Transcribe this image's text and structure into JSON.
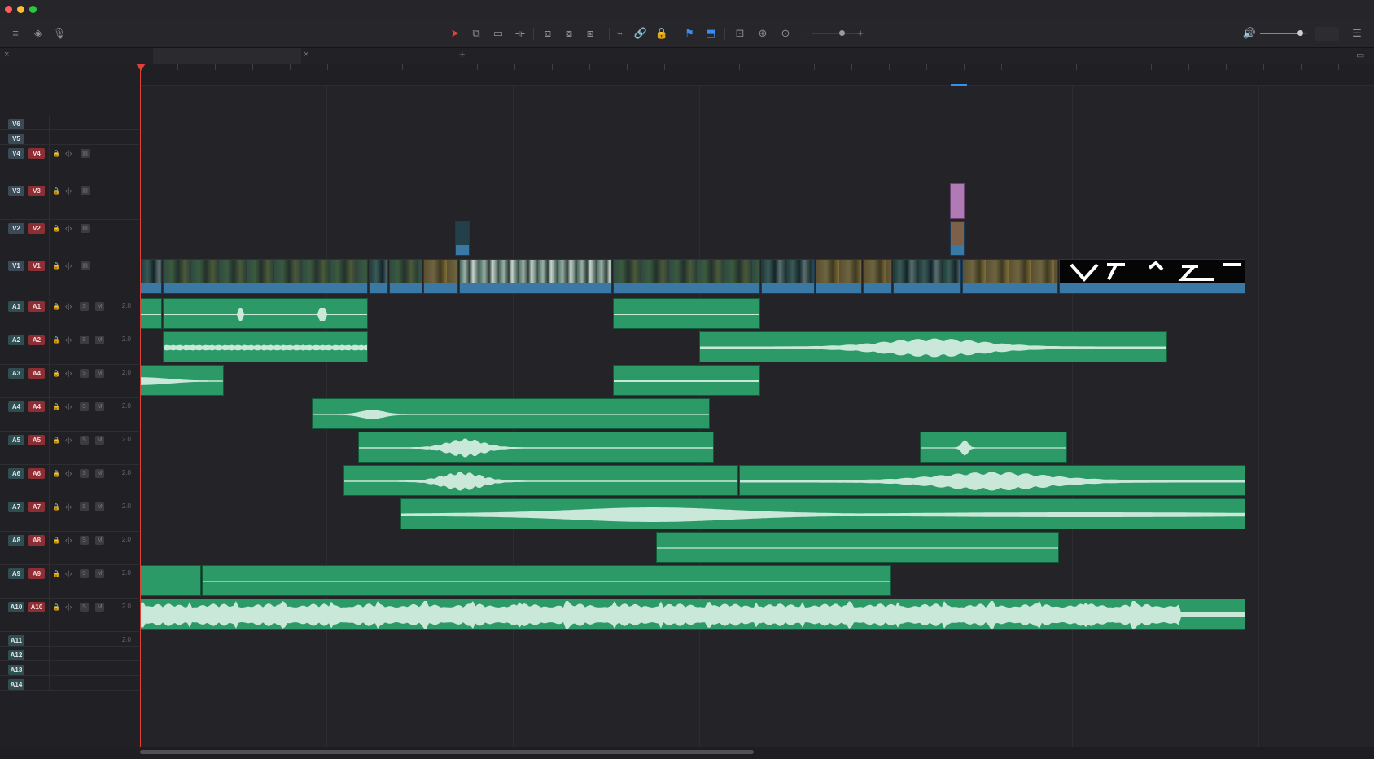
{
  "window": {
    "traffic_lights": [
      {
        "name": "close",
        "color": "#ff5f57"
      },
      {
        "name": "minimize",
        "color": "#febc2e"
      },
      {
        "name": "zoom",
        "color": "#28c840"
      }
    ]
  },
  "toolbar": {
    "left_tools": [
      {
        "name": "timeline-view-options-icon",
        "glyph": "≡"
      },
      {
        "name": "audio-mixer-icon",
        "glyph": "◈"
      },
      {
        "name": "voiceover-mic-icon",
        "glyph": "🎙"
      }
    ],
    "edit_tools": [
      {
        "name": "selection-mode-icon",
        "glyph": "➤",
        "selected": true
      },
      {
        "name": "trim-edit-mode-icon",
        "glyph": "⧉"
      },
      {
        "name": "dynamic-trim-mode-icon",
        "glyph": "▭"
      },
      {
        "name": "blade-edit-mode-icon",
        "glyph": "⟛"
      },
      {
        "name": "insert-clip-icon",
        "glyph": "⧈"
      },
      {
        "name": "overwrite-clip-icon",
        "glyph": "⧇"
      },
      {
        "name": "replace-clip-icon",
        "glyph": "⧆"
      },
      {
        "name": "snapping-icon",
        "glyph": "⌁"
      },
      {
        "name": "linked-selection-icon",
        "glyph": "🔗"
      },
      {
        "name": "position-lock-icon",
        "glyph": "🔒"
      },
      {
        "name": "flag-icon",
        "glyph": "⚑",
        "accent": true
      },
      {
        "name": "marker-icon",
        "glyph": "⬒",
        "accent": true
      },
      {
        "name": "zoom-full-icon",
        "glyph": "⊡"
      },
      {
        "name": "zoom-detail-icon",
        "glyph": "⊕"
      },
      {
        "name": "zoom-custom-icon",
        "glyph": "⊙"
      }
    ],
    "zoom_slider_value": 0.6,
    "volume_level": 0.85,
    "colors": {
      "accent": "#3b8ef0",
      "selected": "#e0433b",
      "volume": "#2fbf5a"
    }
  },
  "tabs": [
    {
      "name": "timeline-tab-1",
      "active": false
    },
    {
      "name": "timeline-tab-2",
      "active": true
    }
  ],
  "tracks": {
    "video": [
      {
        "label": "V6",
        "dest": ""
      },
      {
        "label": "V5",
        "dest": ""
      },
      {
        "label": "V4",
        "dest": "V4"
      },
      {
        "label": "V3",
        "dest": "V3"
      },
      {
        "label": "V2",
        "dest": "V2"
      },
      {
        "label": "V1",
        "dest": "V1"
      }
    ],
    "audio": [
      {
        "label": "A1",
        "dest": "A1",
        "ch": "2.0"
      },
      {
        "label": "A2",
        "dest": "A2",
        "ch": "2.0"
      },
      {
        "label": "A3",
        "dest": "A4",
        "ch": "2.0"
      },
      {
        "label": "A4",
        "dest": "A4",
        "ch": "2.0"
      },
      {
        "label": "A5",
        "dest": "A5",
        "ch": "2.0"
      },
      {
        "label": "A6",
        "dest": "A6",
        "ch": "2.0"
      },
      {
        "label": "A7",
        "dest": "A7",
        "ch": "2.0"
      },
      {
        "label": "A8",
        "dest": "A8",
        "ch": "2.0"
      },
      {
        "label": "A9",
        "dest": "A9",
        "ch": "2.0"
      },
      {
        "label": "A10",
        "dest": "A10",
        "ch": "2.0"
      },
      {
        "label": "A11",
        "dest": "",
        "ch": "2.0"
      },
      {
        "label": "A12",
        "dest": "",
        "ch": ""
      },
      {
        "label": "A13",
        "dest": "",
        "ch": ""
      },
      {
        "label": "A14",
        "dest": "",
        "ch": ""
      }
    ],
    "solo_label": "S",
    "mute_label": "M"
  },
  "colors": {
    "video_clip": "#3a78a6",
    "audio_clip": "#2b9a67",
    "waveform": "#d8efe3",
    "playhead": "#e0403a",
    "dest_badge": "#8d2e34",
    "adjustment_clip": "#b07ab4"
  }
}
